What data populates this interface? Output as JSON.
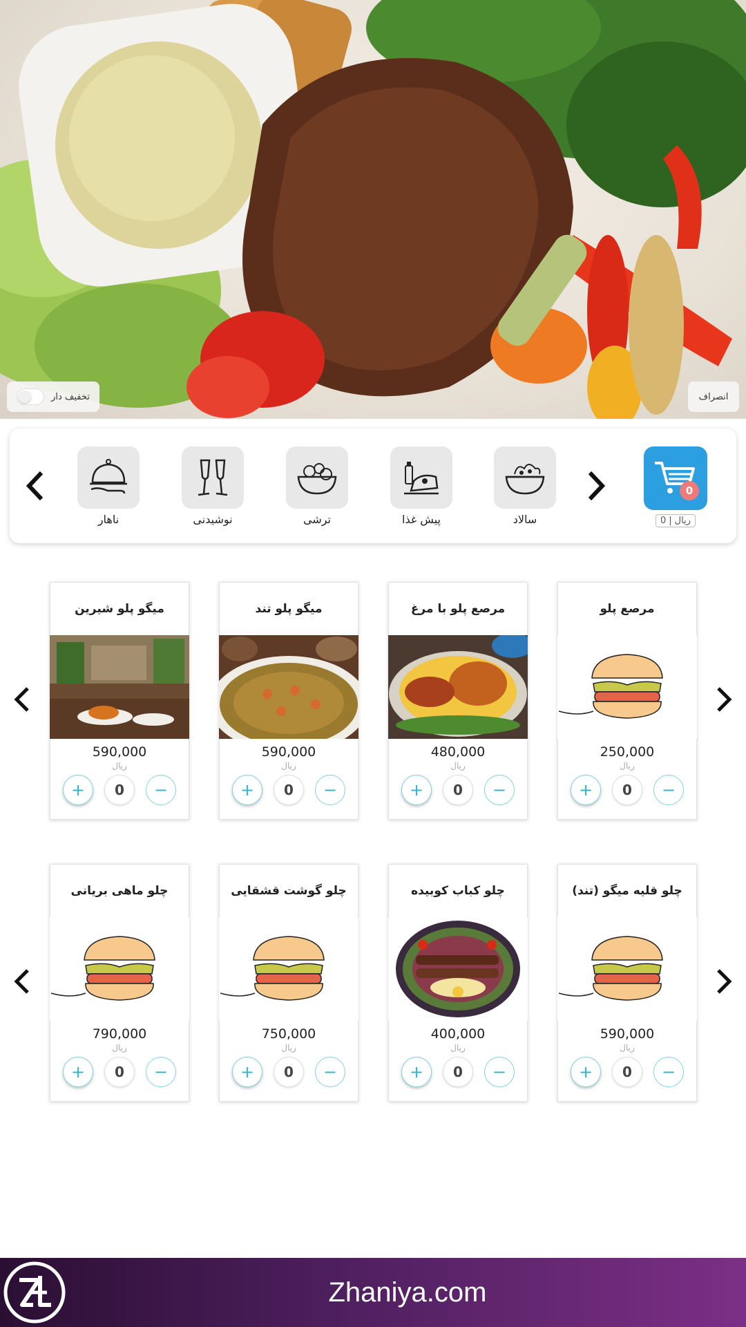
{
  "hero": {
    "cancel_label": "انصراف",
    "discount_label": "تخفیف دار"
  },
  "categories": {
    "items": [
      {
        "label": "ناهار",
        "icon": "cloche-icon"
      },
      {
        "label": "نوشیدنی",
        "icon": "glasses-icon"
      },
      {
        "label": "ترشی",
        "icon": "pickle-bowl-icon"
      },
      {
        "label": "پیش غذا",
        "icon": "appetizer-icon"
      },
      {
        "label": "سالاد",
        "icon": "salad-bowl-icon"
      }
    ],
    "cart": {
      "count": "0",
      "total": "0",
      "currency": "ریال",
      "color": "#2b9fe0",
      "badge_color": "#f07a7a"
    }
  },
  "products": {
    "row1": [
      {
        "name": "میگو پلو شیرین",
        "price": "590,000",
        "currency": "ریال",
        "qty": "0",
        "image": "restaurant-table-photo"
      },
      {
        "name": "میگو پلو تند",
        "price": "590,000",
        "currency": "ریال",
        "qty": "0",
        "image": "shrimp-rice-photo"
      },
      {
        "name": "مرصع پلو با مرغ",
        "price": "480,000",
        "currency": "ریال",
        "qty": "0",
        "image": "saffron-rice-chicken-photo"
      },
      {
        "name": "مرصع پلو",
        "price": "250,000",
        "currency": "ریال",
        "qty": "0",
        "image": "burger-placeholder"
      }
    ],
    "row2": [
      {
        "name": "چلو ماهی بریانی",
        "price": "790,000",
        "currency": "ریال",
        "qty": "0",
        "image": "burger-placeholder"
      },
      {
        "name": "چلو گوشت قشقایی",
        "price": "750,000",
        "currency": "ریال",
        "qty": "0",
        "image": "burger-placeholder"
      },
      {
        "name": "چلو کباب کوبیده",
        "price": "400,000",
        "currency": "ریال",
        "qty": "0",
        "image": "kebab-platter-photo"
      },
      {
        "name": "چلو قلیه میگو (تند)",
        "price": "590,000",
        "currency": "ریال",
        "qty": "0",
        "image": "burger-placeholder"
      }
    ]
  },
  "footer": {
    "site": "Zhaniya.com",
    "logo": "ZH"
  }
}
